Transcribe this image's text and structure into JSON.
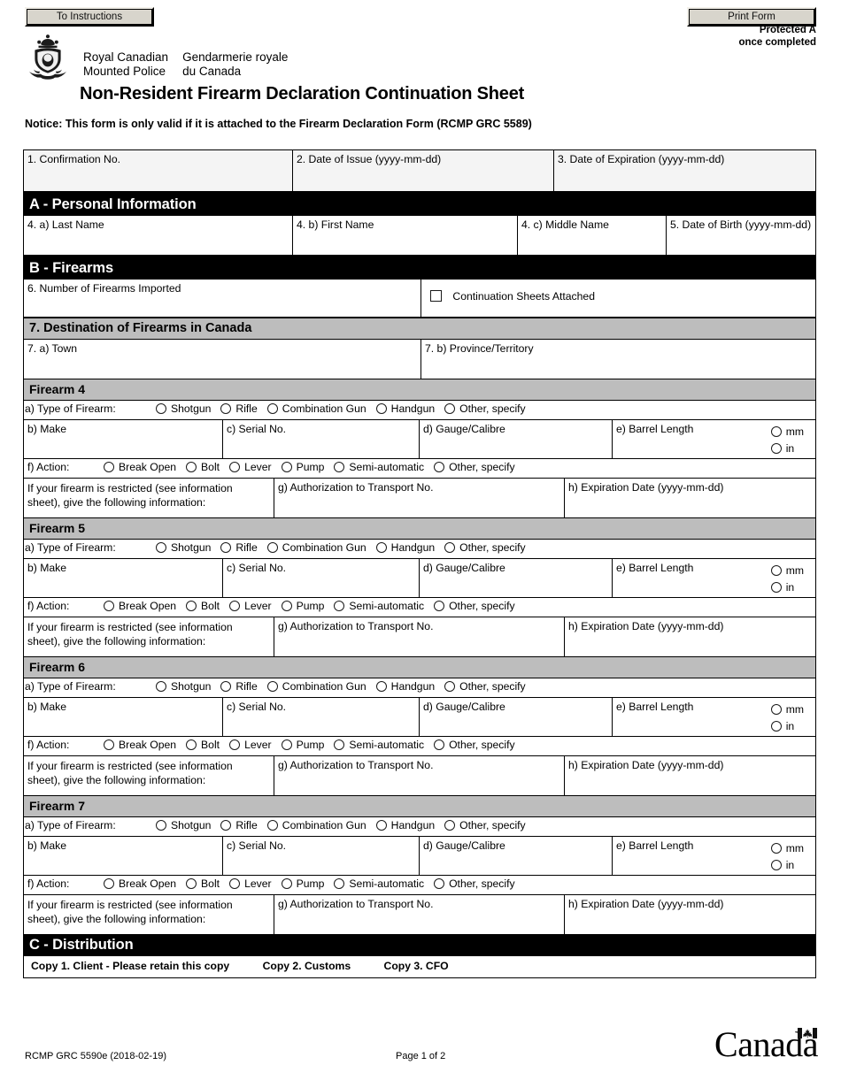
{
  "toolbar": {
    "instructions_label": "To Instructions",
    "print_label": "Print Form"
  },
  "security": {
    "line1": "Protected A",
    "line2": "once completed"
  },
  "organization": {
    "en_line1": "Royal Canadian",
    "en_line2": "Mounted Police",
    "fr_line1": "Gendarmerie royale",
    "fr_line2": "du Canada"
  },
  "document": {
    "title": "Non-Resident Firearm Declaration Continuation Sheet",
    "notice": "Notice: This form is only valid if it is attached to the Firearm Declaration Form (RCMP GRC 5589)"
  },
  "top_row": {
    "confirmation_no": "1. Confirmation No.",
    "date_of_issue": "2. Date of Issue (yyyy-mm-dd)",
    "date_of_expiration": "3. Date of Expiration (yyyy-mm-dd)"
  },
  "section_a": {
    "heading": "A - Personal Information",
    "last_name": "4. a) Last Name",
    "first_name": "4. b) First Name",
    "middle_name": "4. c) Middle Name",
    "date_of_birth": "5. Date of Birth (yyyy-mm-dd)"
  },
  "section_b": {
    "heading": "B - Firearms",
    "number_imported": "6. Number of Firearms Imported",
    "continuation_sheets": "Continuation Sheets Attached"
  },
  "destination": {
    "heading": "7. Destination of Firearms in Canada",
    "town": "7. a) Town",
    "province": "7. b) Province/Territory"
  },
  "firearm_labels": {
    "type_of_firearm": "a) Type of Firearm:",
    "type_options": [
      "Shotgun",
      "Rifle",
      "Combination Gun",
      "Handgun",
      "Other,  specify"
    ],
    "make": "b) Make",
    "serial_no": "c) Serial No.",
    "gauge_calibre": "d) Gauge/Calibre",
    "barrel_length": "e) Barrel Length",
    "unit_mm": "mm",
    "unit_in": "in",
    "action": "f) Action:",
    "action_options": [
      "Break Open",
      "Bolt",
      "Lever",
      "Pump",
      "Semi-automatic",
      "Other,  specify"
    ],
    "restricted_line1": "If your firearm is restricted (see information",
    "restricted_line2": "sheet), give the following information:",
    "att_no": "g) Authorization to Transport No.",
    "expiration_date": "h) Expiration Date (yyyy-mm-dd)"
  },
  "firearms": [
    {
      "heading": "Firearm 4"
    },
    {
      "heading": "Firearm 5"
    },
    {
      "heading": "Firearm 6"
    },
    {
      "heading": "Firearm 7"
    }
  ],
  "section_c": {
    "heading": "C - Distribution",
    "copy1": "Copy 1.  Client - Please retain this copy",
    "copy2": "Copy 2.  Customs",
    "copy3": "Copy 3.  CFO"
  },
  "footer": {
    "form_id": "RCMP GRC 5590e (2018-02-19)",
    "page": "Page 1 of 2",
    "wordmark": "Canada"
  },
  "colors": {
    "band_black": "#000000",
    "band_grey": "#bdbdbd",
    "button_face": "#d8d5cc",
    "top_row_fill": "#f4f4f4"
  }
}
